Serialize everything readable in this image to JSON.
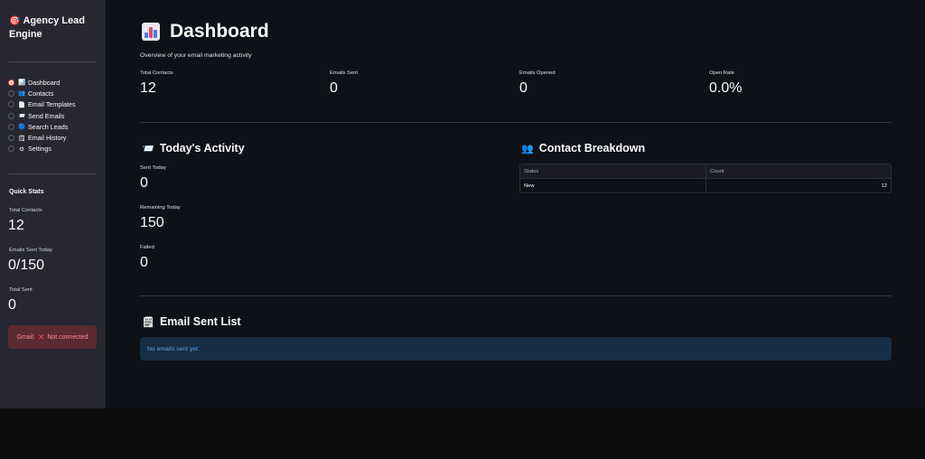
{
  "sidebar": {
    "title": "Agency Lead Engine",
    "title_icon": "target-icon",
    "nav": [
      {
        "label": "Dashboard",
        "icon": "📊",
        "selected": true
      },
      {
        "label": "Contacts",
        "icon": "👥",
        "selected": false
      },
      {
        "label": "Email Templates",
        "icon": "📄",
        "selected": false
      },
      {
        "label": "Send Emails",
        "icon": "📨",
        "selected": false
      },
      {
        "label": "Search Leads",
        "icon": "🔵",
        "selected": false
      },
      {
        "label": "Email History",
        "icon": "🗒",
        "selected": false
      },
      {
        "label": "Settings",
        "icon": "⚙",
        "selected": false
      }
    ],
    "quick_stats": {
      "title": "Quick Stats",
      "total_contacts_label": "Total Contacts",
      "total_contacts_value": "12",
      "sent_today_label": "Emails Sent Today",
      "sent_today_value": "0/150",
      "total_sent_label": "Total Sent",
      "total_sent_value": "0"
    },
    "gmail_status": {
      "label": "Gmail:",
      "status": "Not connected"
    }
  },
  "main": {
    "title": "Dashboard",
    "subtitle": "Overview of your email marketing activity",
    "metrics": [
      {
        "label": "Total Contacts",
        "value": "12"
      },
      {
        "label": "Emails Sent",
        "value": "0"
      },
      {
        "label": "Emails Opened",
        "value": "0"
      },
      {
        "label": "Open Rate",
        "value": "0.0%"
      }
    ],
    "activity": {
      "title": "Today's Activity",
      "items": [
        {
          "label": "Sent Today",
          "value": "0"
        },
        {
          "label": "Remaining Today",
          "value": "150"
        },
        {
          "label": "Failed",
          "value": "0"
        }
      ]
    },
    "breakdown": {
      "title": "Contact Breakdown",
      "columns": [
        "Status",
        "Count"
      ],
      "rows": [
        {
          "status": "New",
          "count": "12"
        }
      ]
    },
    "sent_list": {
      "title": "Email Sent List",
      "empty_message": "No emails sent yet."
    }
  },
  "colors": {
    "accent": "#ff4b4b",
    "background": "#0e1117",
    "sidebar": "#262730",
    "info_bg": "#172d43",
    "info_text": "#5fa8ec",
    "error_bg": "#5c2a31"
  }
}
